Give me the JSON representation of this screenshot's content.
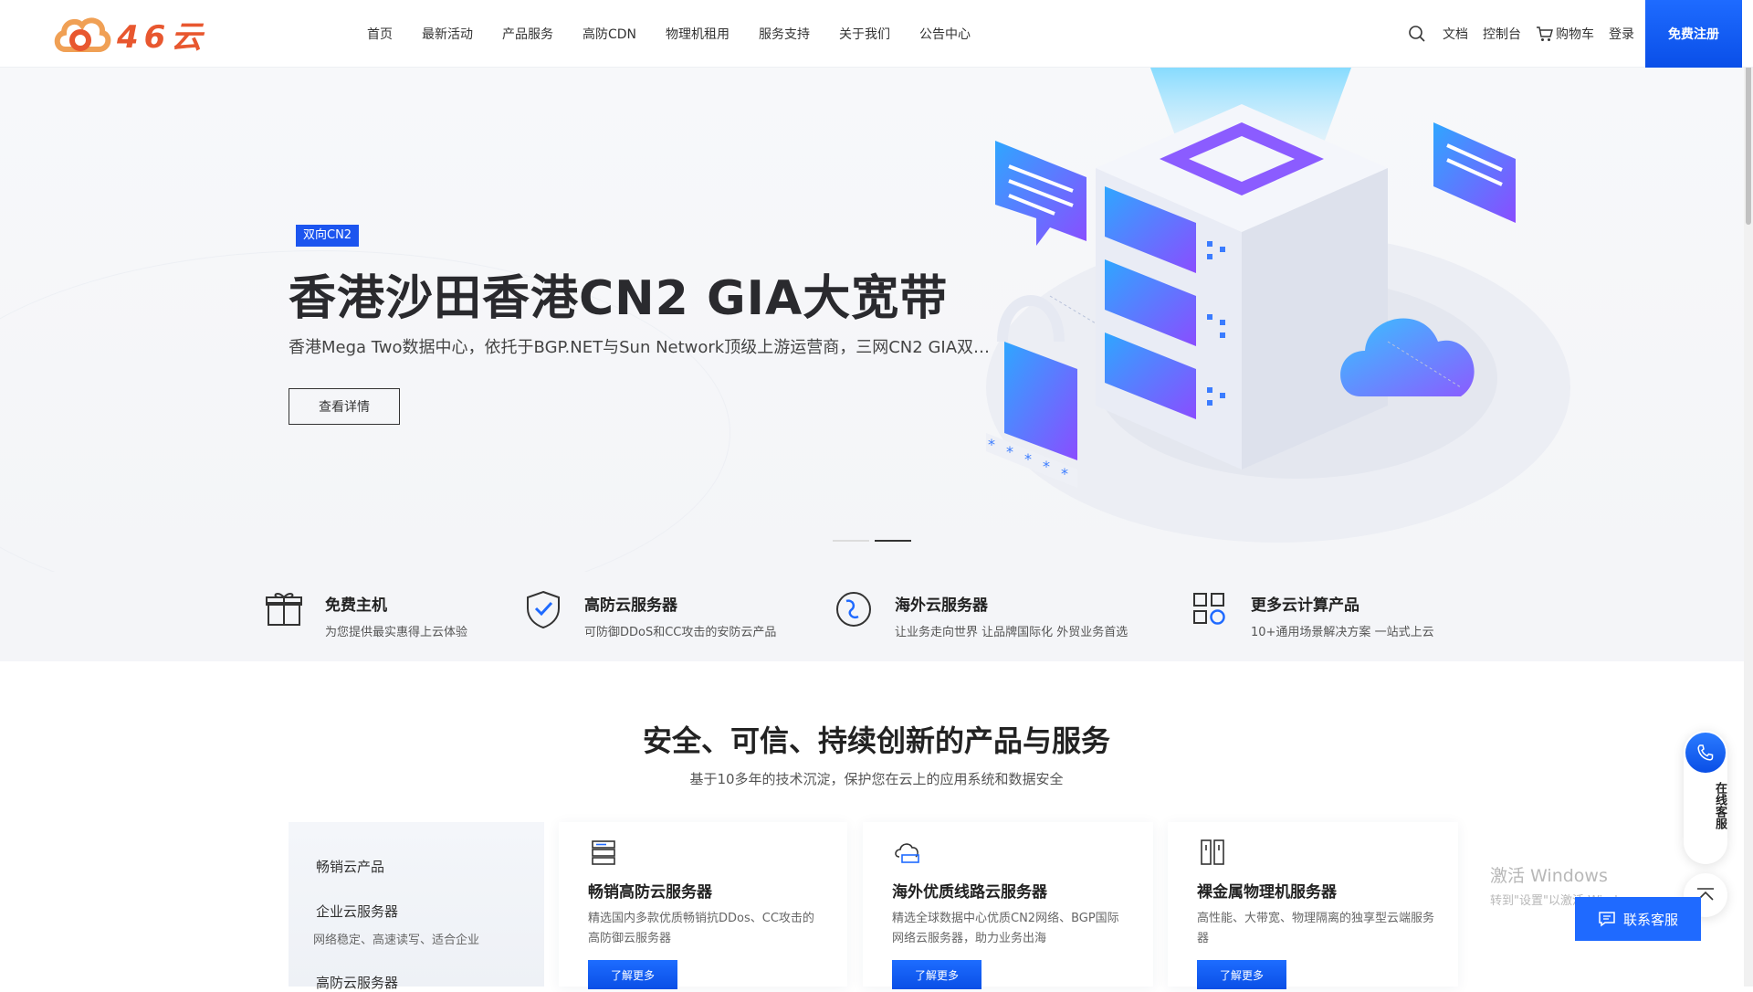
{
  "header": {
    "logo_text": "46云",
    "nav": [
      "首页",
      "最新活动",
      "产品服务",
      "高防CDN",
      "物理机租用",
      "服务支持",
      "关于我们",
      "公告中心"
    ],
    "right": {
      "docs": "文档",
      "console": "控制台",
      "cart": "购物车",
      "login": "登录"
    },
    "register": "免费注册"
  },
  "hero": {
    "badge": "双向CN2",
    "title": "香港沙田香港CN2 GIA大宽带",
    "desc": "香港Mega Two数据中心，依托于BGP.NET与Sun Network顶级上游运营商，三网CN2 GIA双程...",
    "button": "查看详情",
    "slide_count": 2,
    "active_slide": 2
  },
  "features": [
    {
      "title": "免费主机",
      "desc": "为您提供最实惠得上云体验",
      "icon": "gift-icon"
    },
    {
      "title": "高防云服务器",
      "desc": "可防御DDoS和CC攻击的安防云产品",
      "icon": "shield-icon"
    },
    {
      "title": "海外云服务器",
      "desc": "让业务走向世界 让品牌国际化 外贸业务首选",
      "icon": "globe-icon"
    },
    {
      "title": "更多云计算产品",
      "desc": "10+通用场景解决方案 一站式上云",
      "icon": "grid-icon"
    }
  ],
  "section": {
    "title": "安全、可信、持续创新的产品与服务",
    "subtitle": "基于10多年的技术沉淀，保护您在云上的应用系统和数据安全",
    "side": [
      {
        "label": "畅销云产品",
        "sub": ""
      },
      {
        "label": "企业云服务器",
        "sub": "网络稳定、高速读写、适合企业"
      },
      {
        "label": "高防云服务器",
        "sub": ""
      }
    ],
    "cards": [
      {
        "title": "畅销高防云服务器",
        "desc": "精选国内多款优质畅销抗DDos、CC攻击的高防御云服务器",
        "button": "了解更多",
        "icon": "server-list-icon"
      },
      {
        "title": "海外优质线路云服务器",
        "desc": "精选全球数据中心优质CN2网络、BGP国际网络云服务器，助力业务出海",
        "button": "了解更多",
        "icon": "cloud-server-icon"
      },
      {
        "title": "裸金属物理机服务器",
        "desc": "高性能、大带宽、物理隔离的独享型云端服务器",
        "button": "了解更多",
        "icon": "rack-icon"
      }
    ]
  },
  "float": {
    "online_service": "在线客服",
    "contact": "联系客服"
  },
  "watermark": {
    "line1": "激活 Windows",
    "line2": "转到\"设置\"以激活 Windows。"
  },
  "colors": {
    "accent": "#1f6aff",
    "logo": "#e8572f"
  }
}
